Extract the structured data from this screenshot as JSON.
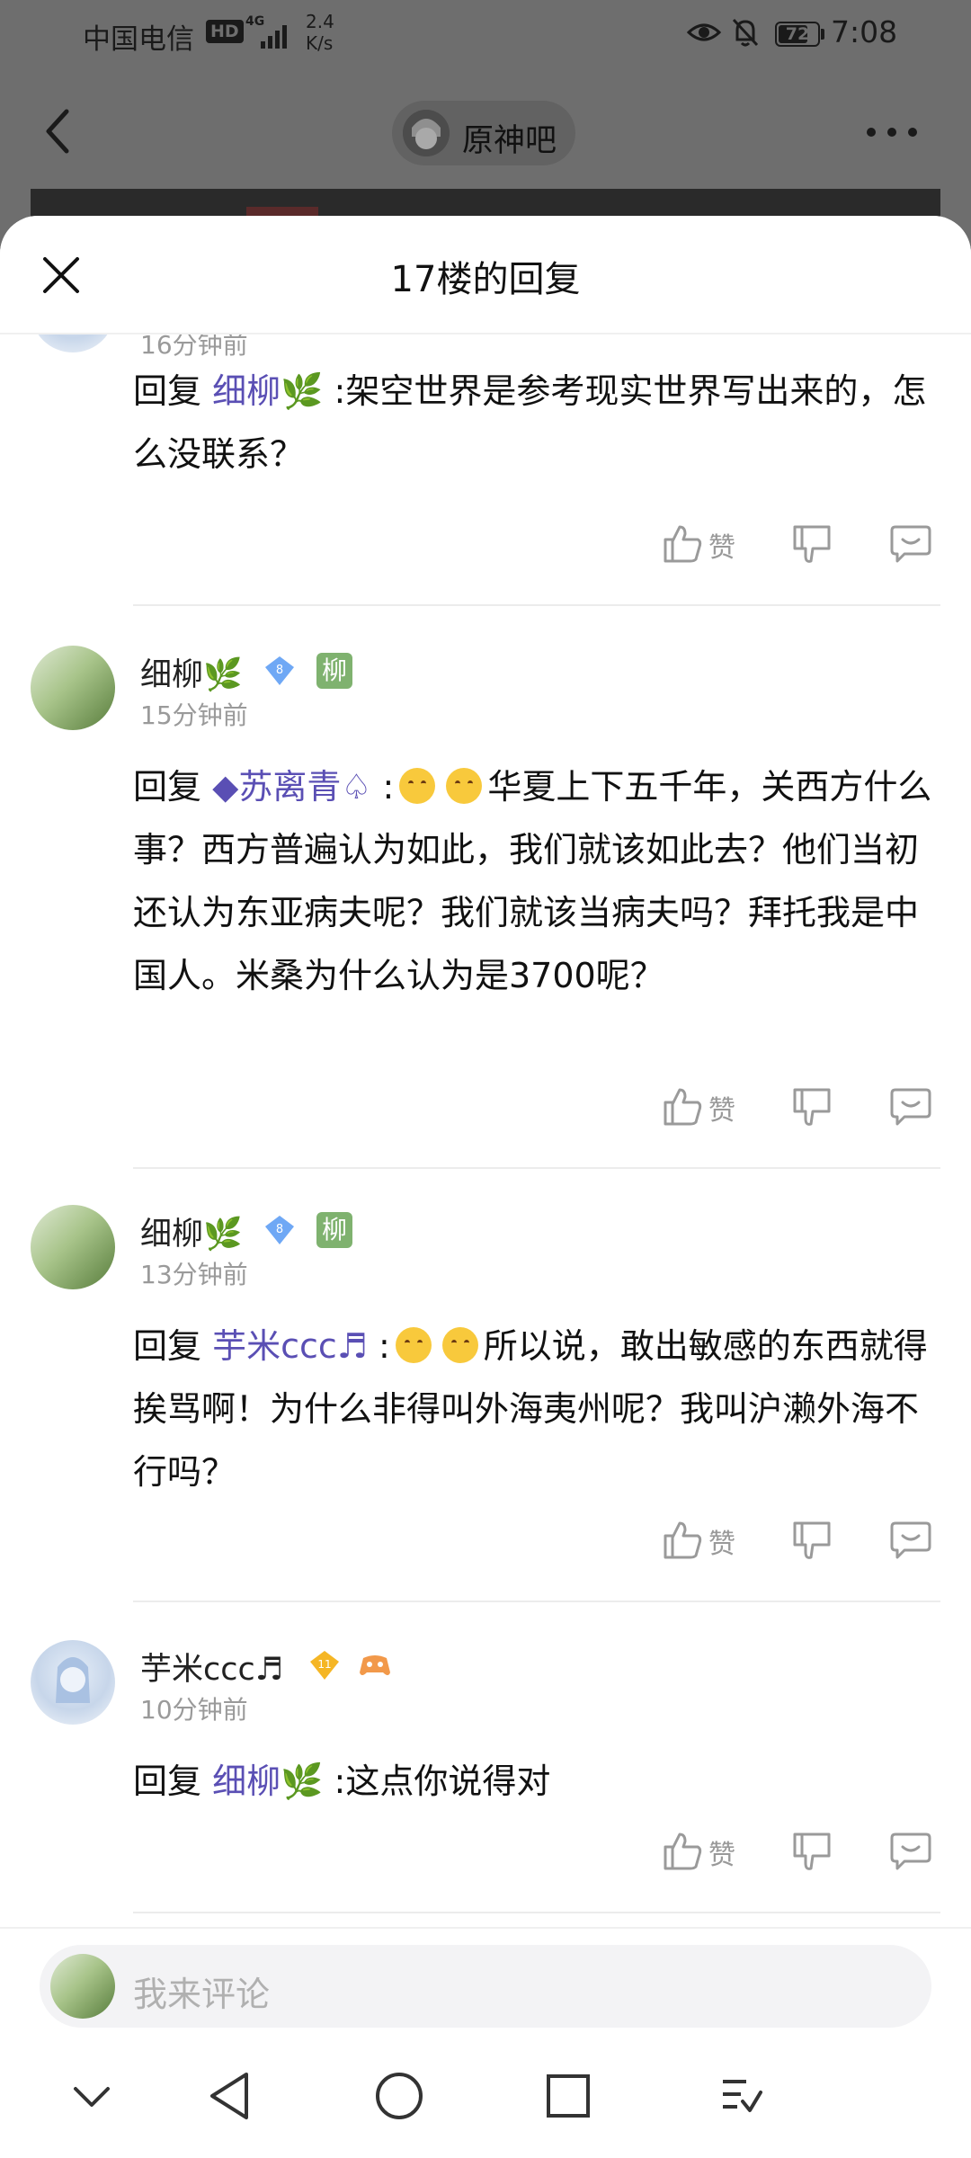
{
  "status_bar": {
    "carrier": "中国电信",
    "hd": "HD",
    "network": "4G",
    "speed_value": "2.4",
    "speed_unit": "K/s",
    "battery": "72",
    "time": "7:08"
  },
  "forum_header": {
    "forum_name": "原神吧"
  },
  "sheet": {
    "title": "17楼的回复"
  },
  "replies": [
    {
      "time": "16分钟前",
      "reply_prefix": "回复",
      "mention": "细柳🌿",
      "sep": ":",
      "text": "架空世界是参考现实世界写出来的，怎么没联系？",
      "like_label": "赞"
    },
    {
      "username": "细柳🌿",
      "level": "8",
      "tag": "柳",
      "time": "15分钟前",
      "reply_prefix": "回复",
      "mention": "◆苏离青♤",
      "sep": ":",
      "text": "华夏上下五千年，关西方什么事？西方普遍认为如此，我们就该如此去？他们当初还认为东亚病夫呢？我们就该当病夫吗？拜托我是中国人。米桑为什么认为是3700呢？",
      "like_label": "赞"
    },
    {
      "username": "细柳🌿",
      "level": "8",
      "tag": "柳",
      "time": "13分钟前",
      "reply_prefix": "回复",
      "mention": "芋米ccc♬",
      "sep": ":",
      "text": "所以说，敢出敏感的东西就得挨骂啊！为什么非得叫外海夷州呢？我叫沪濑外海不行吗？",
      "like_label": "赞"
    },
    {
      "username": "芋米ccc♬",
      "level": "11",
      "time": "10分钟前",
      "reply_prefix": "回复",
      "mention": "细柳🌿",
      "sep": ":",
      "text": "这点你说得对",
      "like_label": "赞"
    }
  ],
  "comment_input": {
    "placeholder": "我来评论"
  },
  "colors": {
    "mention": "#5a4fb4",
    "overlay": "#6e6e6e",
    "tag": "#7fb26f",
    "level_blue": "#6fa8f5",
    "level_gold": "#f5b625"
  },
  "icons": [
    "back-icon",
    "more-icon",
    "close-icon",
    "like-icon",
    "dislike-icon",
    "reply-icon",
    "nav-down-icon",
    "nav-back-icon",
    "nav-home-icon",
    "nav-recent-icon",
    "nav-menu-icon"
  ]
}
